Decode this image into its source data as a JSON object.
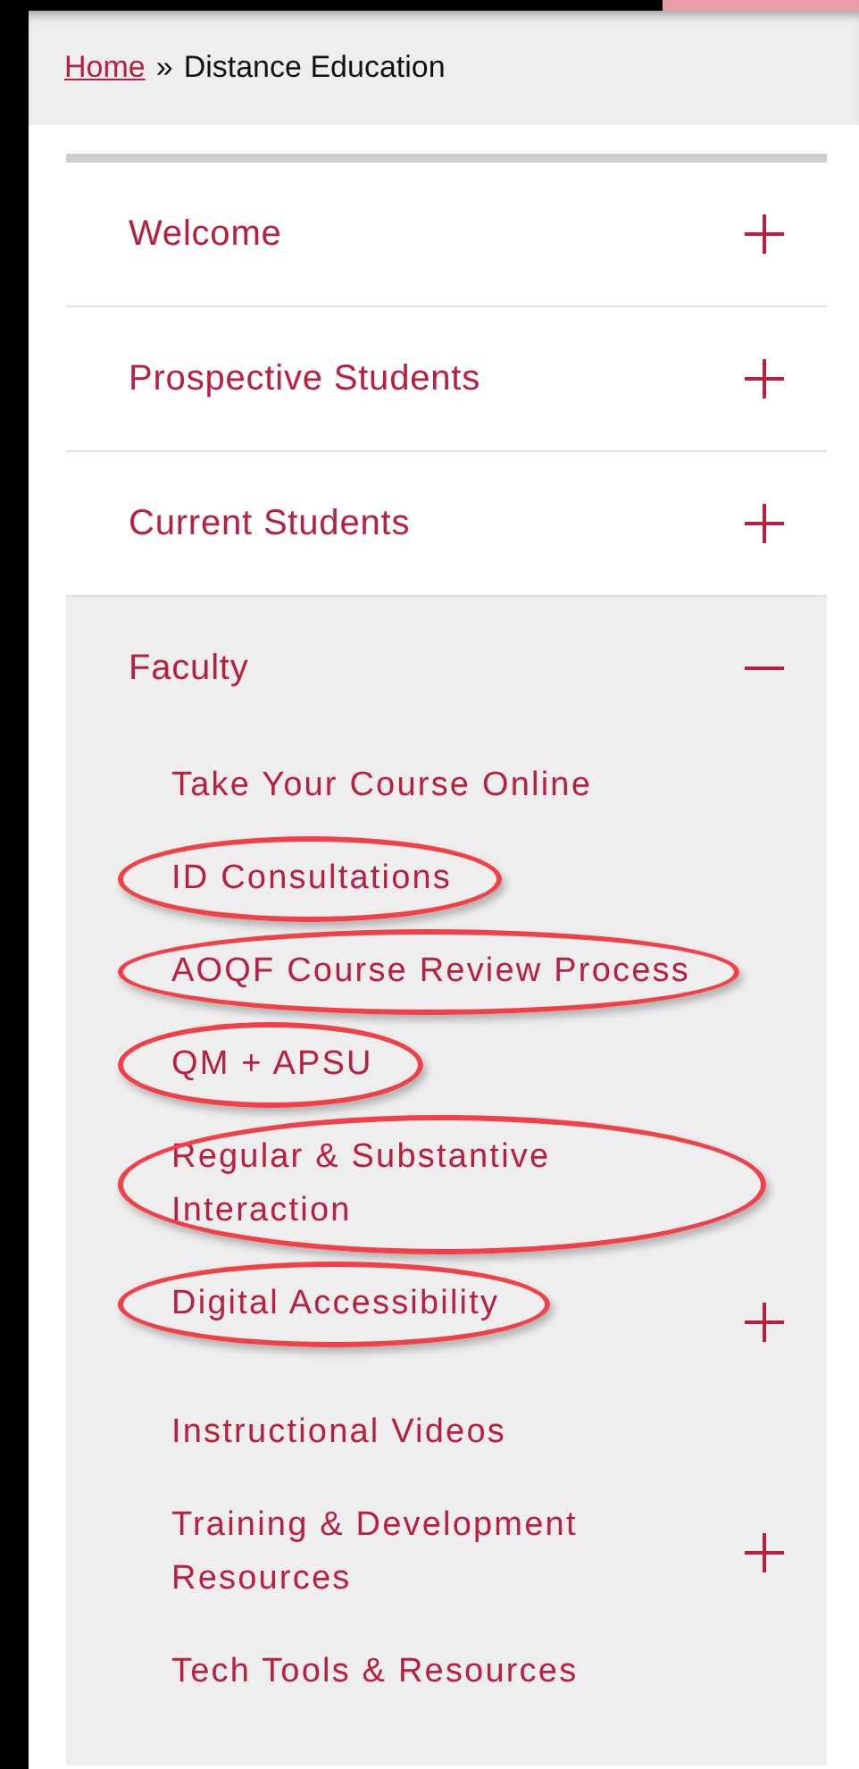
{
  "breadcrumb": {
    "link": "Home",
    "separator": "»",
    "current": "Distance Education"
  },
  "menu": [
    {
      "label": "Welcome",
      "expanded": false
    },
    {
      "label": "Prospective Students",
      "expanded": false
    },
    {
      "label": "Current Students",
      "expanded": false
    },
    {
      "label": "Faculty",
      "expanded": true,
      "children": [
        {
          "label": "Take Your Course Online",
          "circled": false,
          "expandable": false
        },
        {
          "label": "ID Consultations",
          "circled": true,
          "expandable": false
        },
        {
          "label": "AOQF Course Review Process",
          "circled": true,
          "expandable": false
        },
        {
          "label": "QM + APSU",
          "circled": true,
          "expandable": false
        },
        {
          "label": "Regular & Substantive Interaction",
          "circled": true,
          "expandable": false
        },
        {
          "label": "Digital Accessibility",
          "circled": true,
          "expandable": true
        },
        {
          "label": "Instructional Videos",
          "circled": false,
          "expandable": false
        },
        {
          "label": "Training & Development Resources",
          "circled": false,
          "expandable": true
        },
        {
          "label": "Tech Tools & Resources",
          "circled": false,
          "expandable": false
        }
      ]
    }
  ]
}
